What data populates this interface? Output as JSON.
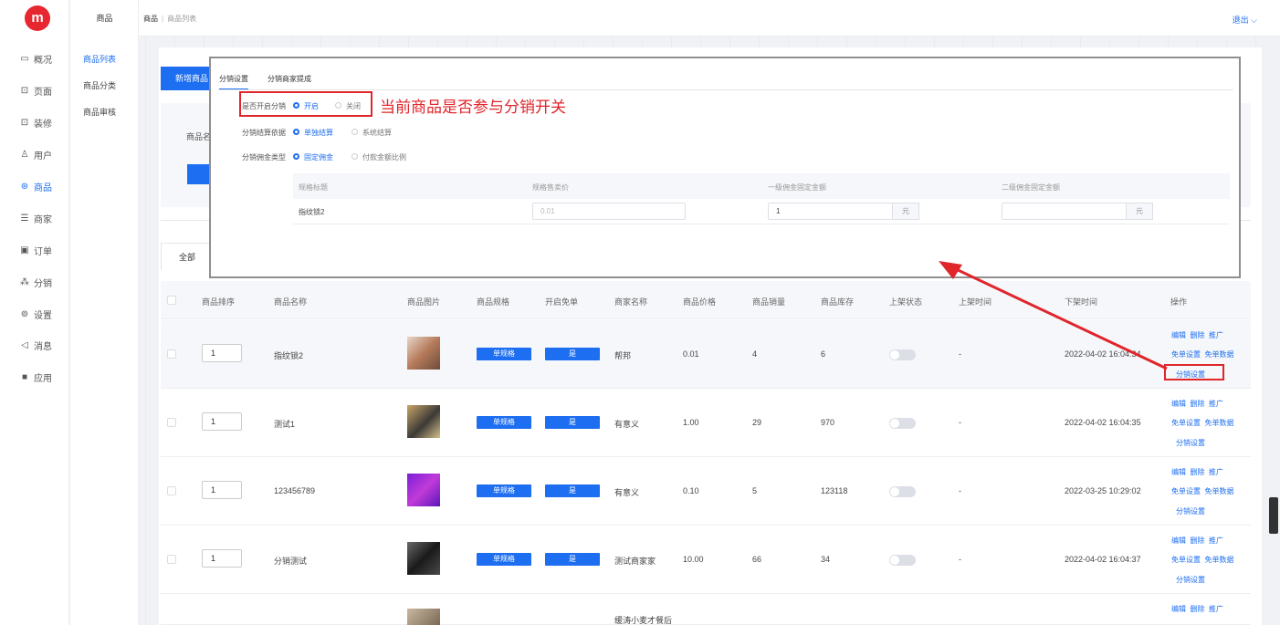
{
  "app": {
    "logo_text": "m"
  },
  "sidebar": {
    "items": [
      {
        "label": "概况",
        "icon": "dashboard-icon",
        "glyph": "▭"
      },
      {
        "label": "页面",
        "icon": "page-icon",
        "glyph": "⊡"
      },
      {
        "label": "装修",
        "icon": "decorate-icon",
        "glyph": "⊡"
      },
      {
        "label": "用户",
        "icon": "user-icon",
        "glyph": "♙"
      },
      {
        "label": "商品",
        "icon": "goods-icon",
        "glyph": "⊛"
      },
      {
        "label": "商家",
        "icon": "merchant-icon",
        "glyph": "☰"
      },
      {
        "label": "订单",
        "icon": "order-icon",
        "glyph": "▣"
      },
      {
        "label": "分销",
        "icon": "distribution-icon",
        "glyph": "⁂"
      },
      {
        "label": "设置",
        "icon": "settings-icon",
        "glyph": "⊚"
      },
      {
        "label": "消息",
        "icon": "message-icon",
        "glyph": "◁"
      },
      {
        "label": "应用",
        "icon": "apps-icon",
        "glyph": "■"
      }
    ],
    "active": "商品"
  },
  "subnav": {
    "title": "商品",
    "items": [
      "商品列表",
      "商品分类",
      "商品审核"
    ],
    "active": "商品列表"
  },
  "header": {
    "breadcrumb": [
      "商品",
      "商品列表"
    ],
    "logout": "退出 ⌵"
  },
  "toolbar": {
    "new_button": "新增商品",
    "filter_label": "商品名"
  },
  "tabs": {
    "all": "全部"
  },
  "table": {
    "headers": [
      "商品排序",
      "商品名称",
      "商品图片",
      "商品规格",
      "开启免单",
      "商家名称",
      "商品价格",
      "商品销量",
      "商品库存",
      "上架状态",
      "上架时间",
      "下架时间",
      "操作"
    ],
    "rows": [
      {
        "sort": "1",
        "name": "指纹锁2",
        "spec": "单规格",
        "free": "是",
        "merchant": "帮邦",
        "price": "0.01",
        "sales": "4",
        "stock": "6",
        "on_time": "-",
        "off_time": "2022-04-02 16:04:34"
      },
      {
        "sort": "1",
        "name": "测试1",
        "spec": "单规格",
        "free": "是",
        "merchant": "有意义",
        "price": "1.00",
        "sales": "29",
        "stock": "970",
        "on_time": "-",
        "off_time": "2022-04-02 16:04:35"
      },
      {
        "sort": "1",
        "name": "123456789",
        "spec": "单规格",
        "free": "是",
        "merchant": "有意义",
        "price": "0.10",
        "sales": "5",
        "stock": "123118",
        "on_time": "-",
        "off_time": "2022-03-25 10:29:02"
      },
      {
        "sort": "1",
        "name": "分销测试",
        "spec": "单规格",
        "free": "是",
        "merchant": "测试商家家",
        "price": "10.00",
        "sales": "66",
        "stock": "34",
        "on_time": "-",
        "off_time": "2022-04-02 16:04:37"
      }
    ],
    "ops": {
      "edit": "编辑",
      "delete": "删除",
      "promote": "推广",
      "free_set": "免单设置",
      "free_data": "免单数据",
      "dist_set": "分销设置"
    },
    "partial_merchant": "缓涛小麦才餐后"
  },
  "popup": {
    "tabs": [
      "分销设置",
      "分销商家提成"
    ],
    "enable_label": "是否开启分销",
    "enable_on": "开启",
    "enable_off": "关闭",
    "settle_label": "分销结算依据",
    "settle_opt1": "单独结算",
    "settle_opt2": "系统结算",
    "comm_label": "分销佣金类型",
    "comm_opt1": "固定佣金",
    "comm_opt2": "付款金额比例",
    "spec_headers": [
      "规格标题",
      "规格售卖价",
      "一级佣金固定金额",
      "二级佣金固定金额"
    ],
    "spec_row": {
      "title": "指纹锁2",
      "price": "0.01",
      "level1": "1",
      "level1_unit": "元",
      "level2": "",
      "level2_unit": "元"
    }
  },
  "annotation": {
    "note": "当前商品是否参与分销开关",
    "color": "#e0252b"
  },
  "colors": {
    "accent": "#1d6ef0",
    "logo": "#e6272f"
  }
}
